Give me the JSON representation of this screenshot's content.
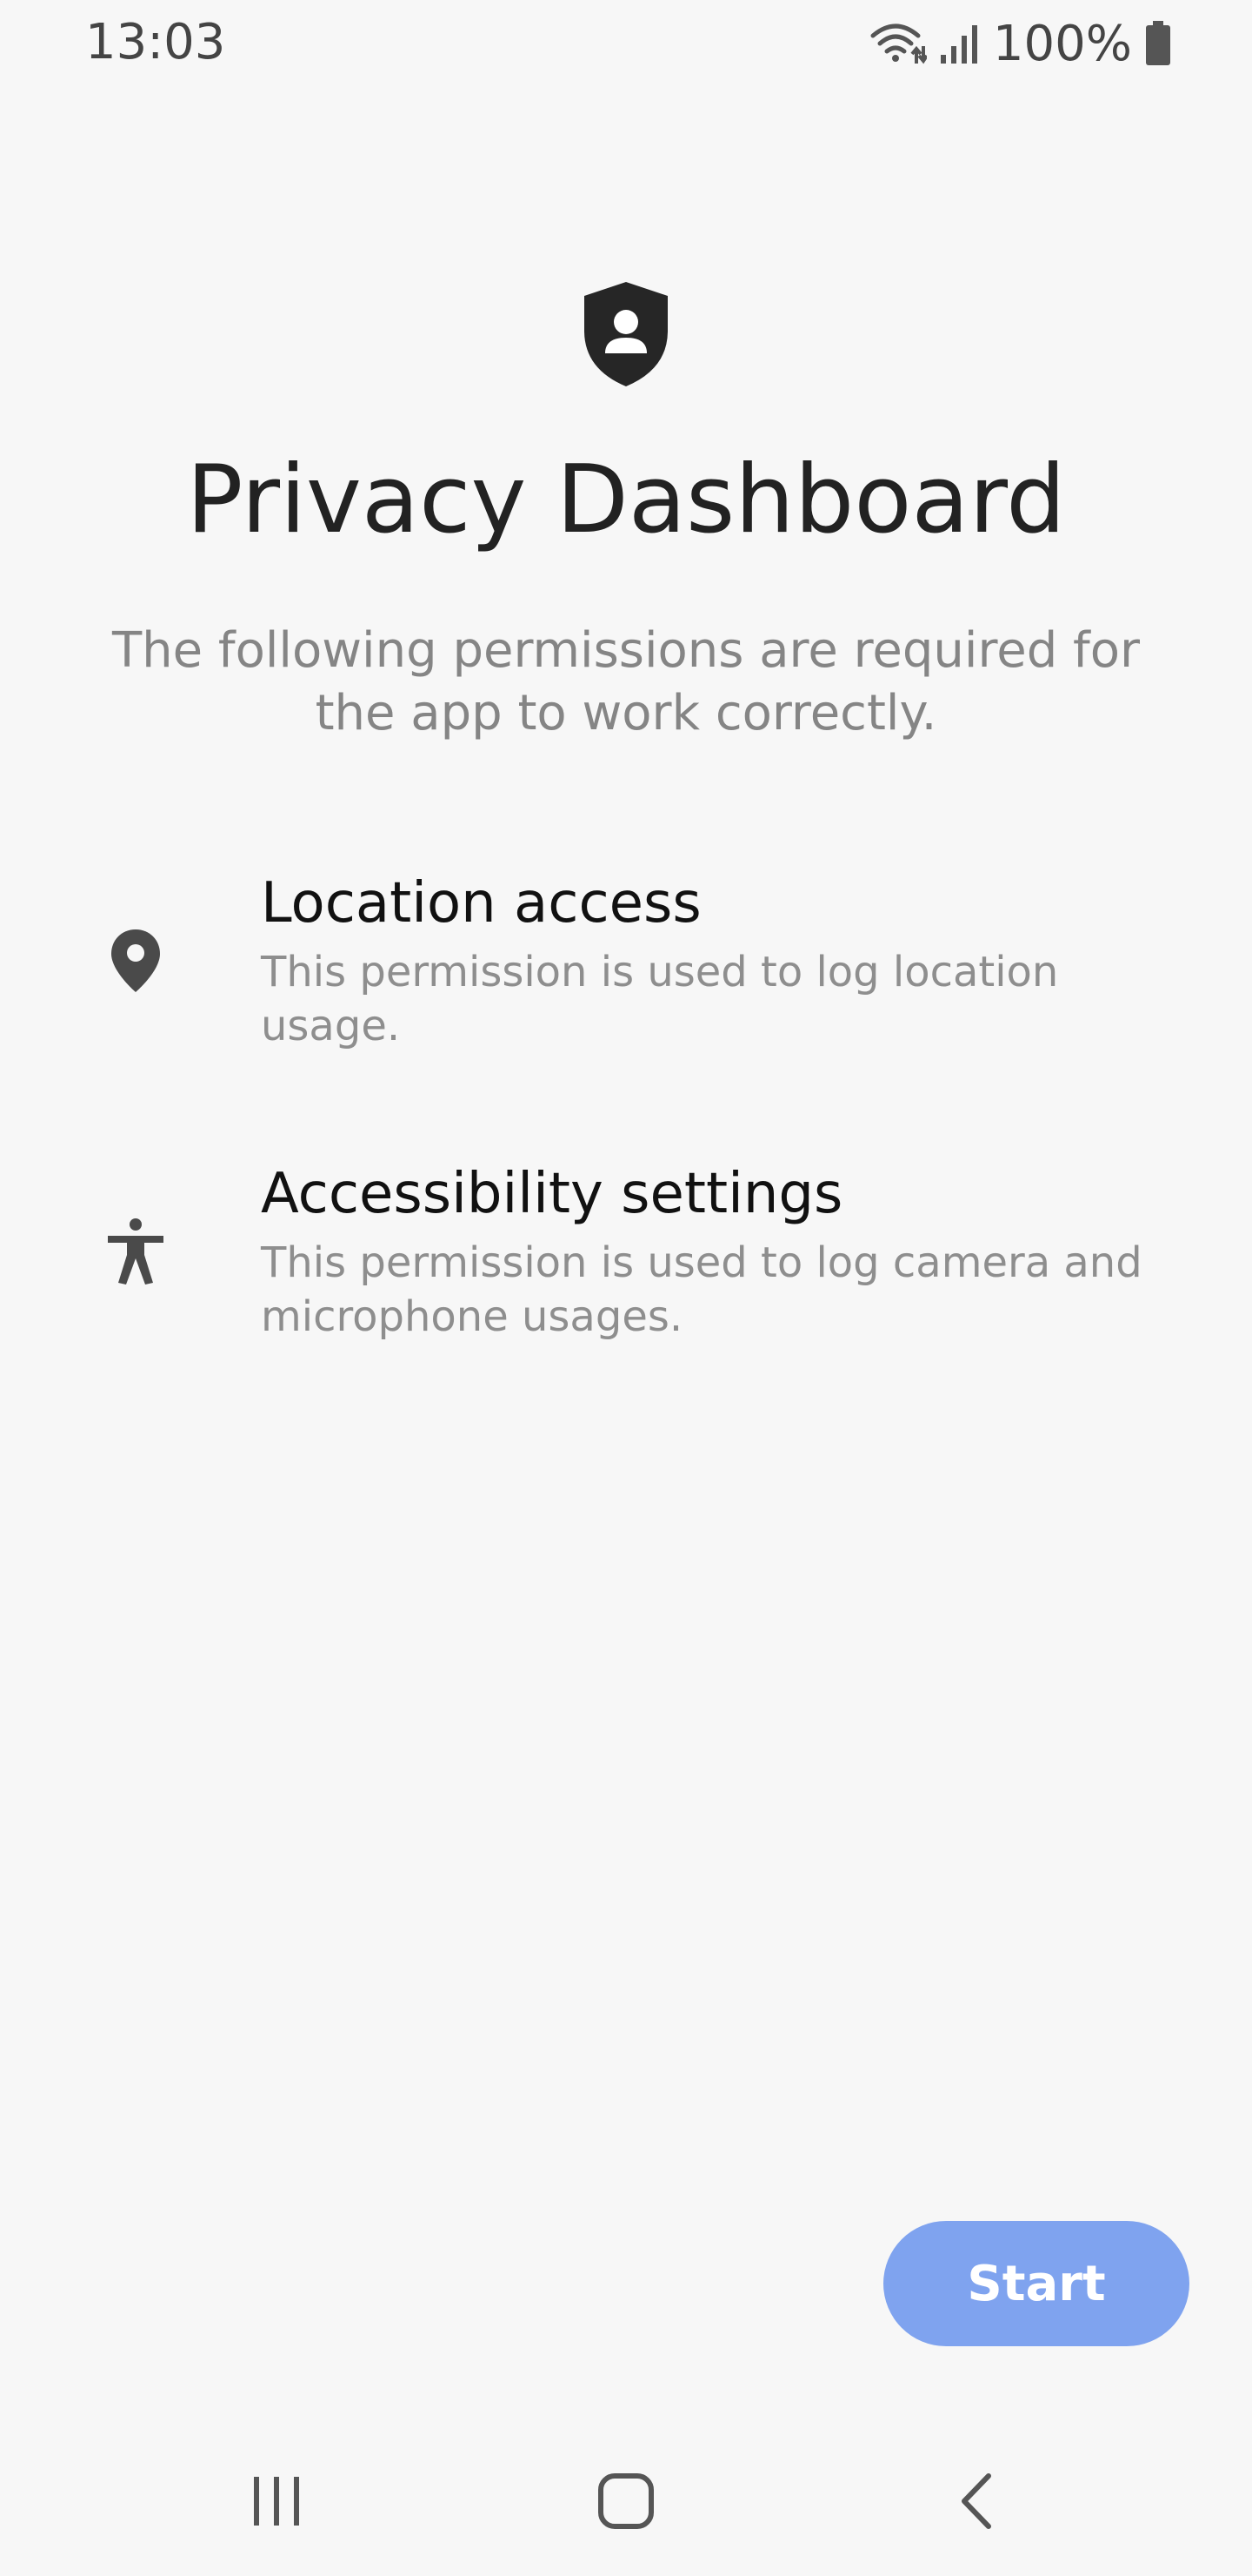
{
  "status_bar": {
    "time": "13:03",
    "battery_text": "100%",
    "icons": [
      "wifi-icon",
      "signal-icon",
      "battery-icon"
    ]
  },
  "header": {
    "icon": "privacy-shield-icon",
    "title": "Privacy Dashboard",
    "subtitle": "The following permissions are required for the app to work correctly."
  },
  "permissions": [
    {
      "icon": "location-pin-icon",
      "title": "Location access",
      "description": "This permission is used to log location usage."
    },
    {
      "icon": "accessibility-icon",
      "title": "Accessibility settings",
      "description": "This permission is used to log camera and microphone usages."
    }
  ],
  "actions": {
    "start_label": "Start",
    "start_color": "#7fa3ef"
  },
  "nav_bar": {
    "icons": [
      "recents-icon",
      "home-icon",
      "back-icon"
    ]
  }
}
